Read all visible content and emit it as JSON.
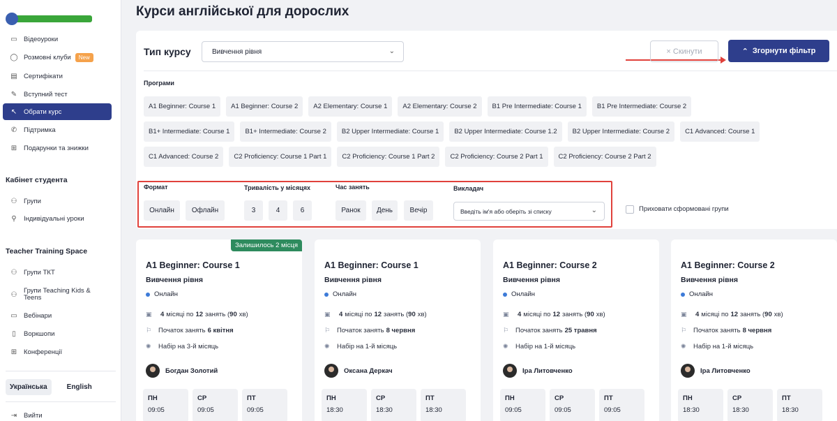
{
  "page_title": "Курси англійської для дорослих",
  "sidebar": {
    "items": [
      {
        "label": "Відеоуроки",
        "icon": "video-icon"
      },
      {
        "label": "Розмовні клуби",
        "icon": "chat-icon",
        "badge": "New"
      },
      {
        "label": "Сертифікати",
        "icon": "certificate-icon"
      },
      {
        "label": "Вступний тест",
        "icon": "test-icon"
      },
      {
        "label": "Обрати курс",
        "icon": "cursor-icon",
        "active": true
      },
      {
        "label": "Підтримка",
        "icon": "phone-icon"
      },
      {
        "label": "Подарунки та знижки",
        "icon": "gift-icon"
      }
    ],
    "cabinet_heading": "Кабінет студента",
    "cabinet_items": [
      {
        "label": "Групи",
        "icon": "group-icon"
      },
      {
        "label": "Індивідуальні уроки",
        "icon": "person-icon"
      }
    ],
    "ttt_heading": "Teacher Training Space",
    "ttt_items": [
      {
        "label": "Групи ТКТ",
        "icon": "group-icon"
      },
      {
        "label": "Групи Teaching Kids & Teens",
        "icon": "group-icon"
      },
      {
        "label": "Вебінари",
        "icon": "monitor-icon"
      },
      {
        "label": "Воркшопи",
        "icon": "tablet-icon"
      },
      {
        "label": "Конференції",
        "icon": "grid-icon"
      }
    ],
    "lang_ua": "Українська",
    "lang_en": "English",
    "logout": "Вийти"
  },
  "filter": {
    "type_label": "Тип курсу",
    "type_value": "Вивчення рівня",
    "reset_label": "× Скинути",
    "collapse_label": "Згорнути фільтр",
    "programs_label": "Програми",
    "programs_rows": [
      [
        "A1 Beginner: Course 1",
        "A1 Beginner: Course 2",
        "A2 Elementary: Course 1",
        "A2 Elementary: Course 2",
        "B1 Pre Intermediate: Course 1",
        "B1 Pre Intermediate: Course 2"
      ],
      [
        "B1+ Intermediate: Course 1",
        "B1+ Intermediate: Course 2",
        "B2 Upper Intermediate: Course 1",
        "B2 Upper Intermediate: Course 1.2",
        "B2 Upper Intermediate: Course 2",
        "C1 Advanced: Course 1"
      ],
      [
        "C1 Advanced: Course 2",
        "C2 Proficiency: Course 1 Part 1",
        "C2 Proficiency: Course 1 Part 2",
        "C2 Proficiency: Course 2 Part 1",
        "C2 Proficiency: Course 2 Part 2"
      ]
    ],
    "format_label": "Формат",
    "format_online": "Онлайн",
    "format_offline": "Офлайн",
    "duration_label": "Тривалість у місяцях",
    "dur_3": "3",
    "dur_4": "4",
    "dur_6": "6",
    "time_label": "Час занять",
    "time_morning": "Ранок",
    "time_day": "День",
    "time_evening": "Вечір",
    "teacher_label": "Викладач",
    "teacher_placeholder": "Введіть ім'я або оберіть зі списку",
    "hide_label": "Приховати сформовані групи"
  },
  "cards": [
    {
      "tag": "Залишилось 2 місця",
      "title": "A1 Beginner: Course 1",
      "subtitle": "Вивчення рівня",
      "format": "Онлайн",
      "months": "4",
      "lessons": "12",
      "minutes": "90",
      "start": "6 квітня",
      "enroll": "Набір на 3-й місяць",
      "teacher": "Богдан Золотий",
      "days": [
        {
          "d": "ПН",
          "t": "09:05"
        },
        {
          "d": "СР",
          "t": "09:05"
        },
        {
          "d": "ПТ",
          "t": "09:05"
        }
      ]
    },
    {
      "tag": "",
      "title": "A1 Beginner: Course 1",
      "subtitle": "Вивчення рівня",
      "format": "Онлайн",
      "months": "4",
      "lessons": "12",
      "minutes": "90",
      "start": "8 червня",
      "enroll": "Набір на 1-й місяць",
      "teacher": "Оксана Деркач",
      "days": [
        {
          "d": "ПН",
          "t": "18:30"
        },
        {
          "d": "СР",
          "t": "18:30"
        },
        {
          "d": "ПТ",
          "t": "18:30"
        }
      ]
    },
    {
      "tag": "",
      "title": "A1 Beginner: Course 2",
      "subtitle": "Вивчення рівня",
      "format": "Онлайн",
      "months": "4",
      "lessons": "12",
      "minutes": "90",
      "start": "25 травня",
      "enroll": "Набір на 1-й місяць",
      "teacher": "Іра Литовченко",
      "days": [
        {
          "d": "ПН",
          "t": "09:05"
        },
        {
          "d": "СР",
          "t": "09:05"
        },
        {
          "d": "ПТ",
          "t": "09:05"
        }
      ]
    },
    {
      "tag": "",
      "title": "A1 Beginner: Course 2",
      "subtitle": "Вивчення рівня",
      "format": "Онлайн",
      "months": "4",
      "lessons": "12",
      "minutes": "90",
      "start": "8 червня",
      "enroll": "Набір на 1-й місяць",
      "teacher": "Іра Литовченко",
      "days": [
        {
          "d": "ПН",
          "t": "18:30"
        },
        {
          "d": "СР",
          "t": "18:30"
        },
        {
          "d": "ПТ",
          "t": "18:30"
        }
      ]
    }
  ],
  "card_text": {
    "months_word": "місяці по",
    "lessons_word": "занять (",
    "minutes_word": "хв)",
    "start_word": "Початок занять"
  }
}
